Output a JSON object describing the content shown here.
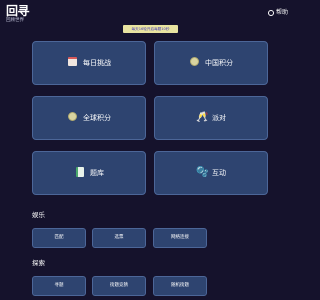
{
  "header": {
    "logo": "回寻",
    "subtitle": "回顾世界",
    "help_label": "帮助"
  },
  "notice": {
    "text": "每天16轮开启每题10秒"
  },
  "tiles": [
    {
      "label": "每日挑战",
      "icon": "calendar-icon"
    },
    {
      "label": "中国积分",
      "icon": "coin-icon"
    },
    {
      "label": "全球积分",
      "icon": "coin-icon"
    },
    {
      "label": "派对",
      "icon": "party-icon"
    },
    {
      "label": "题库",
      "icon": "book-icon"
    },
    {
      "label": "互动",
      "icon": "bubbles-icon"
    }
  ],
  "entertainment": {
    "title": "娱乐",
    "buttons": [
      "匹配",
      "选票",
      "网络连接"
    ]
  },
  "explore": {
    "title": "探索",
    "buttons": [
      "寻题",
      "街题竞猜",
      "随机街题"
    ]
  },
  "colors": {
    "background": "#15122c",
    "tile": "#2e4470",
    "tile_border": "#4c6698",
    "notice_bg": "#e8e3a0"
  }
}
